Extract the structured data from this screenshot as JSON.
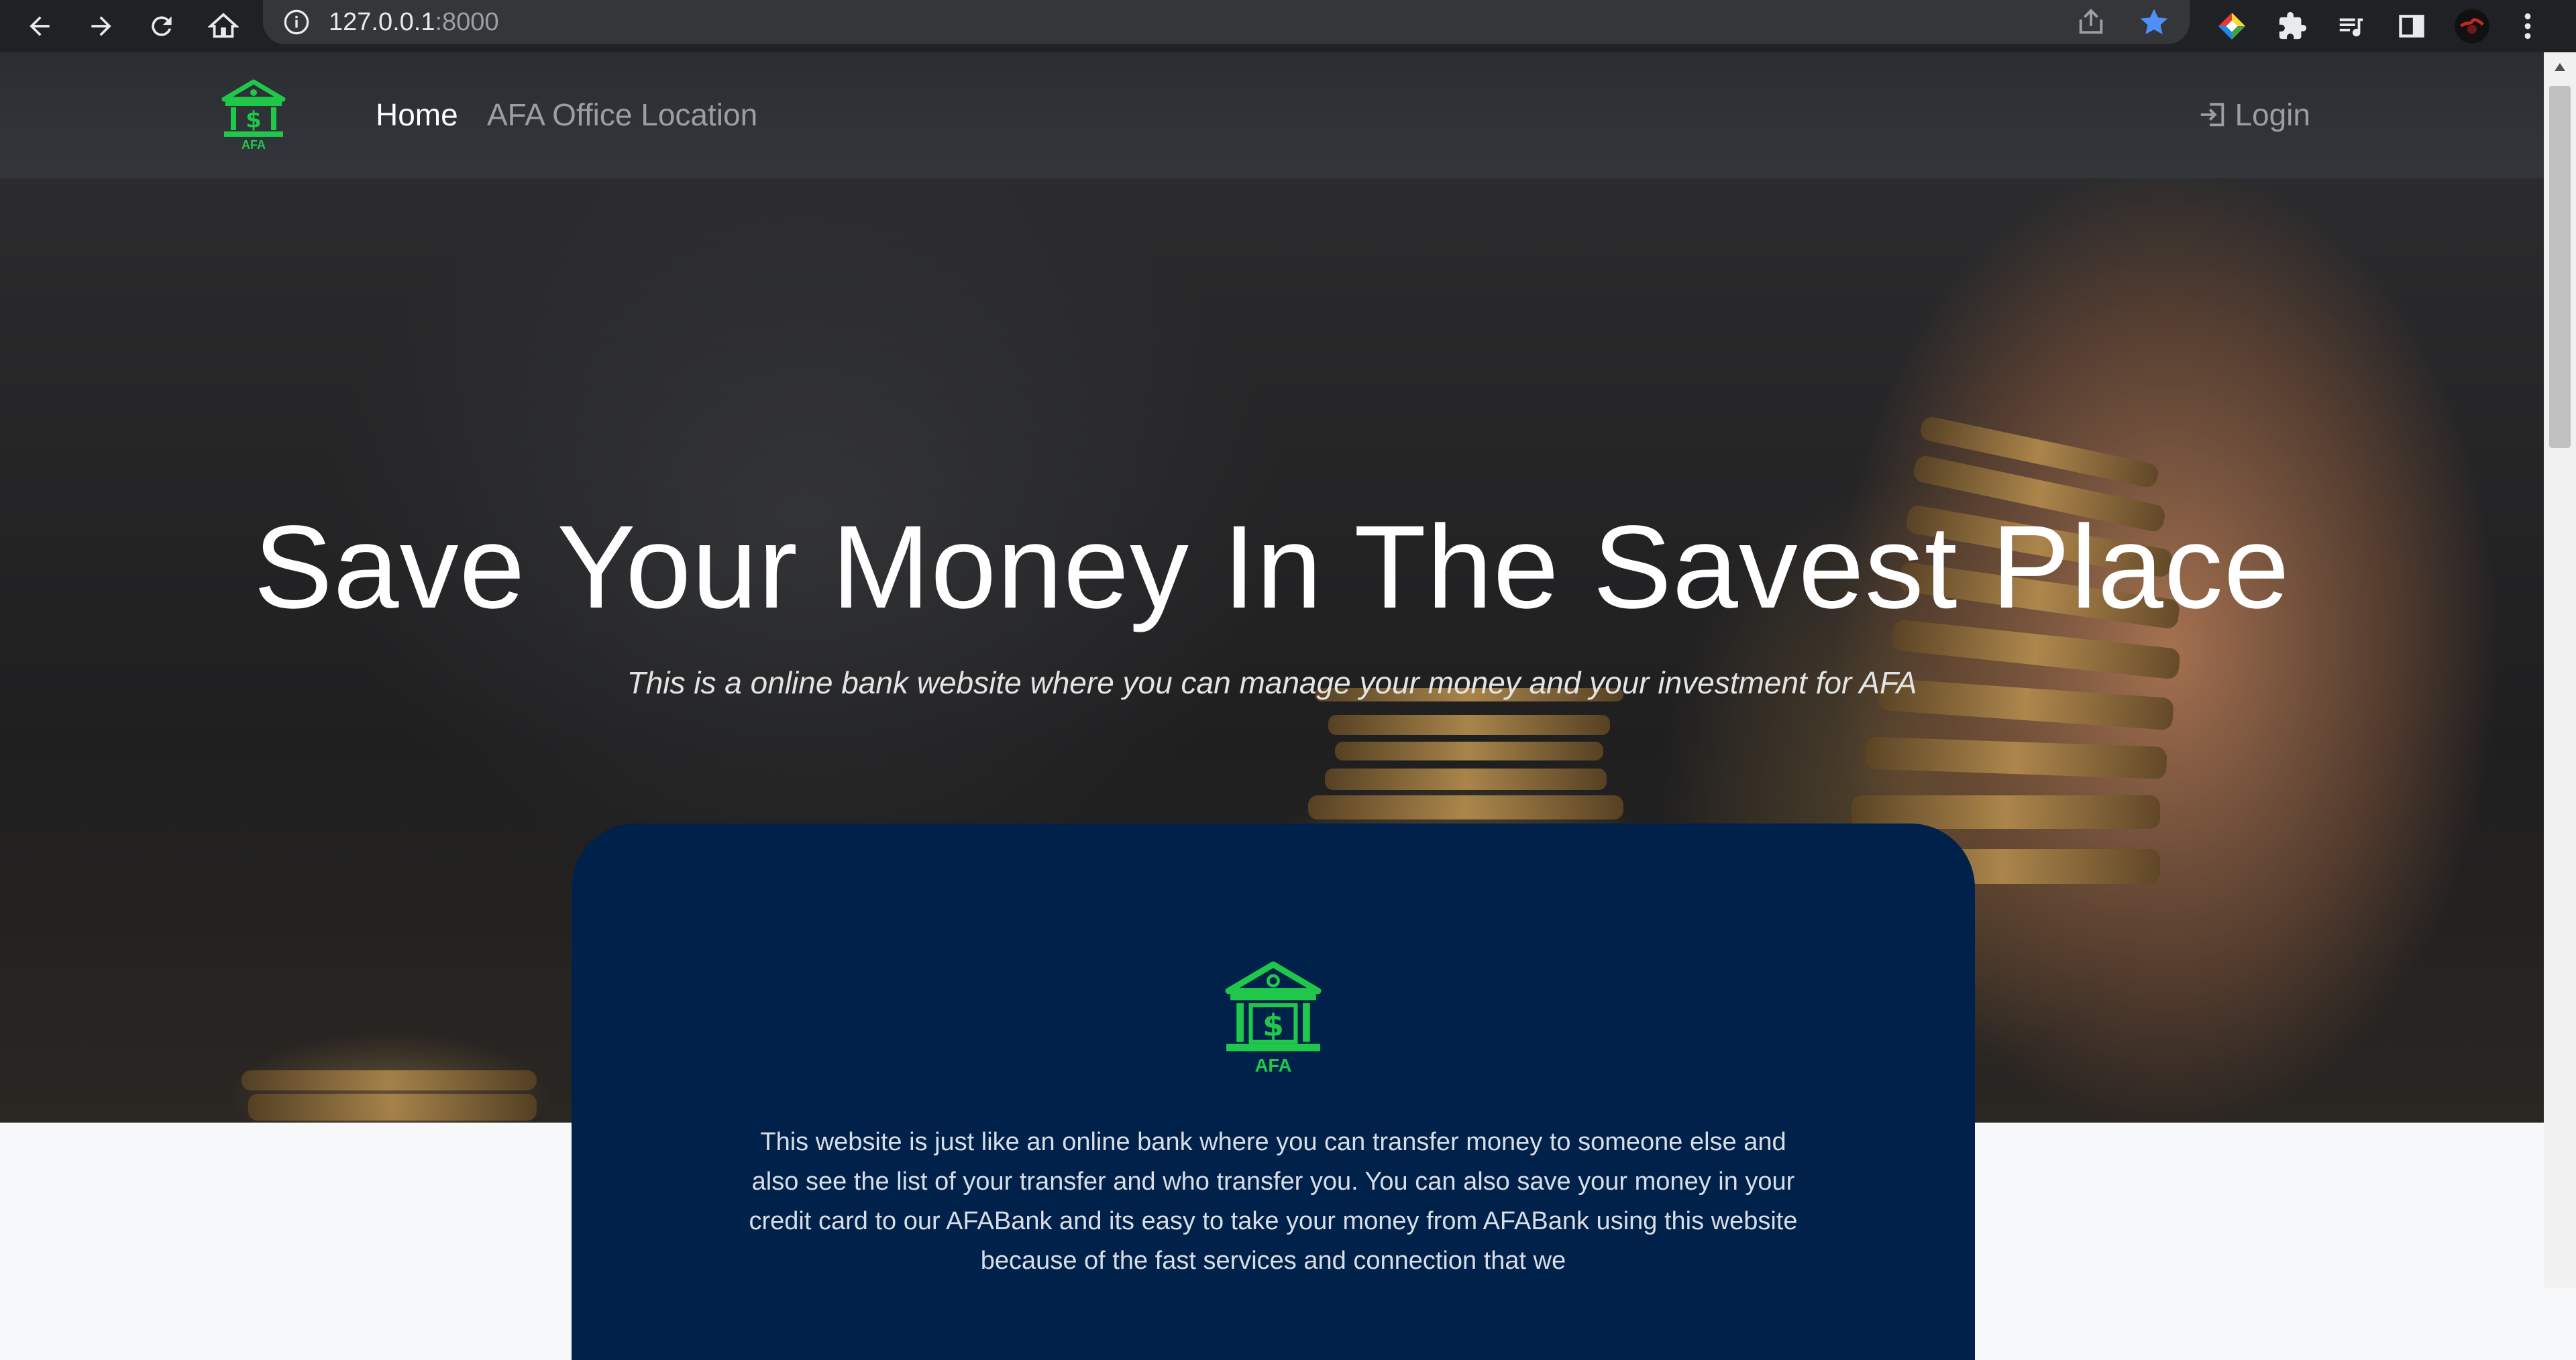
{
  "browser": {
    "url_host": "127.0.0.1",
    "url_port": ":8000"
  },
  "navbar": {
    "brand_text": "AFA",
    "links": [
      "Home",
      "AFA Office Location"
    ],
    "login_label": "Login"
  },
  "hero": {
    "title": "Save Your Money In The Savest Place",
    "subtitle": "This is a online bank website where you can manage your money and your investment for AFA"
  },
  "card": {
    "logo_text": "AFA",
    "description": "This website is just like an online bank where you can transfer money to someone else and also see the list of your transfer and who transfer you. You can also save your money in your credit card to our AFABank and its easy to take your money from AFABank using this website because of the fast services and connection that we"
  },
  "colors": {
    "brand_green": "#1fc84a",
    "card_navy": "#00224a",
    "navbar_dark": "#2f3236",
    "bookmark_blue": "#4e8ff8"
  }
}
